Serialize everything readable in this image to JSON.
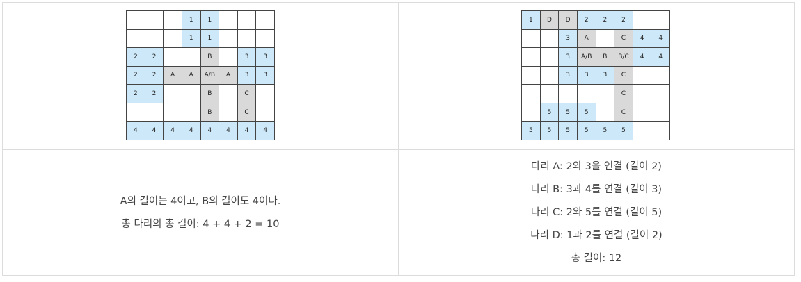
{
  "grids": [
    {
      "name": "example-1-grid",
      "rows": [
        [
          {
            "t": "",
            "k": "e"
          },
          {
            "t": "",
            "k": "e"
          },
          {
            "t": "",
            "k": "e"
          },
          {
            "t": "1",
            "k": "i"
          },
          {
            "t": "1",
            "k": "i"
          },
          {
            "t": "",
            "k": "e"
          },
          {
            "t": "",
            "k": "e"
          },
          {
            "t": "",
            "k": "e"
          }
        ],
        [
          {
            "t": "",
            "k": "e"
          },
          {
            "t": "",
            "k": "e"
          },
          {
            "t": "",
            "k": "e"
          },
          {
            "t": "1",
            "k": "i"
          },
          {
            "t": "1",
            "k": "i"
          },
          {
            "t": "",
            "k": "e"
          },
          {
            "t": "",
            "k": "e"
          },
          {
            "t": "",
            "k": "e"
          }
        ],
        [
          {
            "t": "2",
            "k": "i"
          },
          {
            "t": "2",
            "k": "i"
          },
          {
            "t": "",
            "k": "e"
          },
          {
            "t": "",
            "k": "e"
          },
          {
            "t": "B",
            "k": "b"
          },
          {
            "t": "",
            "k": "e"
          },
          {
            "t": "3",
            "k": "i"
          },
          {
            "t": "3",
            "k": "i"
          }
        ],
        [
          {
            "t": "2",
            "k": "i"
          },
          {
            "t": "2",
            "k": "i"
          },
          {
            "t": "A",
            "k": "b"
          },
          {
            "t": "A",
            "k": "b"
          },
          {
            "t": "A/B",
            "k": "b"
          },
          {
            "t": "A",
            "k": "b"
          },
          {
            "t": "3",
            "k": "i"
          },
          {
            "t": "3",
            "k": "i"
          }
        ],
        [
          {
            "t": "2",
            "k": "i"
          },
          {
            "t": "2",
            "k": "i"
          },
          {
            "t": "",
            "k": "e"
          },
          {
            "t": "",
            "k": "e"
          },
          {
            "t": "B",
            "k": "b"
          },
          {
            "t": "",
            "k": "e"
          },
          {
            "t": "C",
            "k": "b"
          },
          {
            "t": "",
            "k": "e"
          }
        ],
        [
          {
            "t": "",
            "k": "e"
          },
          {
            "t": "",
            "k": "e"
          },
          {
            "t": "",
            "k": "e"
          },
          {
            "t": "",
            "k": "e"
          },
          {
            "t": "B",
            "k": "b"
          },
          {
            "t": "",
            "k": "e"
          },
          {
            "t": "C",
            "k": "b"
          },
          {
            "t": "",
            "k": "e"
          }
        ],
        [
          {
            "t": "4",
            "k": "i"
          },
          {
            "t": "4",
            "k": "i"
          },
          {
            "t": "4",
            "k": "i"
          },
          {
            "t": "4",
            "k": "i"
          },
          {
            "t": "4",
            "k": "i"
          },
          {
            "t": "4",
            "k": "i"
          },
          {
            "t": "4",
            "k": "i"
          },
          {
            "t": "4",
            "k": "i"
          }
        ]
      ]
    },
    {
      "name": "example-2-grid",
      "rows": [
        [
          {
            "t": "1",
            "k": "i"
          },
          {
            "t": "D",
            "k": "b"
          },
          {
            "t": "D",
            "k": "b"
          },
          {
            "t": "2",
            "k": "i"
          },
          {
            "t": "2",
            "k": "i"
          },
          {
            "t": "2",
            "k": "i"
          },
          {
            "t": "",
            "k": "e"
          },
          {
            "t": "",
            "k": "e"
          }
        ],
        [
          {
            "t": "",
            "k": "e"
          },
          {
            "t": "",
            "k": "e"
          },
          {
            "t": "3",
            "k": "i"
          },
          {
            "t": "A",
            "k": "b"
          },
          {
            "t": "",
            "k": "e"
          },
          {
            "t": "C",
            "k": "b"
          },
          {
            "t": "4",
            "k": "i"
          },
          {
            "t": "4",
            "k": "i"
          }
        ],
        [
          {
            "t": "",
            "k": "e"
          },
          {
            "t": "",
            "k": "e"
          },
          {
            "t": "3",
            "k": "i"
          },
          {
            "t": "A/B",
            "k": "b"
          },
          {
            "t": "B",
            "k": "b"
          },
          {
            "t": "B/C",
            "k": "b"
          },
          {
            "t": "4",
            "k": "i"
          },
          {
            "t": "4",
            "k": "i"
          }
        ],
        [
          {
            "t": "",
            "k": "e"
          },
          {
            "t": "",
            "k": "e"
          },
          {
            "t": "3",
            "k": "i"
          },
          {
            "t": "3",
            "k": "i"
          },
          {
            "t": "3",
            "k": "i"
          },
          {
            "t": "C",
            "k": "b"
          },
          {
            "t": "",
            "k": "e"
          },
          {
            "t": "",
            "k": "e"
          }
        ],
        [
          {
            "t": "",
            "k": "e"
          },
          {
            "t": "",
            "k": "e"
          },
          {
            "t": "",
            "k": "e"
          },
          {
            "t": "",
            "k": "e"
          },
          {
            "t": "",
            "k": "e"
          },
          {
            "t": "C",
            "k": "b"
          },
          {
            "t": "",
            "k": "e"
          },
          {
            "t": "",
            "k": "e"
          }
        ],
        [
          {
            "t": "",
            "k": "e"
          },
          {
            "t": "5",
            "k": "i"
          },
          {
            "t": "5",
            "k": "i"
          },
          {
            "t": "5",
            "k": "i"
          },
          {
            "t": "",
            "k": "e"
          },
          {
            "t": "C",
            "k": "b"
          },
          {
            "t": "",
            "k": "e"
          },
          {
            "t": "",
            "k": "e"
          }
        ],
        [
          {
            "t": "5",
            "k": "i"
          },
          {
            "t": "5",
            "k": "i"
          },
          {
            "t": "5",
            "k": "i"
          },
          {
            "t": "5",
            "k": "i"
          },
          {
            "t": "5",
            "k": "i"
          },
          {
            "t": "5",
            "k": "i"
          },
          {
            "t": "",
            "k": "e"
          },
          {
            "t": "",
            "k": "e"
          }
        ]
      ]
    }
  ],
  "colors": {
    "island": "#cde8f8",
    "bridge": "#d9d9d9",
    "empty": "#ffffff"
  },
  "left_text": [
    "A의 길이는 4이고, B의 길이도 4이다.",
    "총 다리의 총 길이: 4 + 4 + 2 = 10"
  ],
  "right_text": [
    "다리 A: 2와 3을 연결 (길이 2)",
    "다리 B: 3과 4를 연결 (길이 3)",
    "다리 C: 2와 5를 연결 (길이 5)",
    "다리 D: 1과 2를 연결 (길이 2)",
    "총 길이: 12"
  ]
}
